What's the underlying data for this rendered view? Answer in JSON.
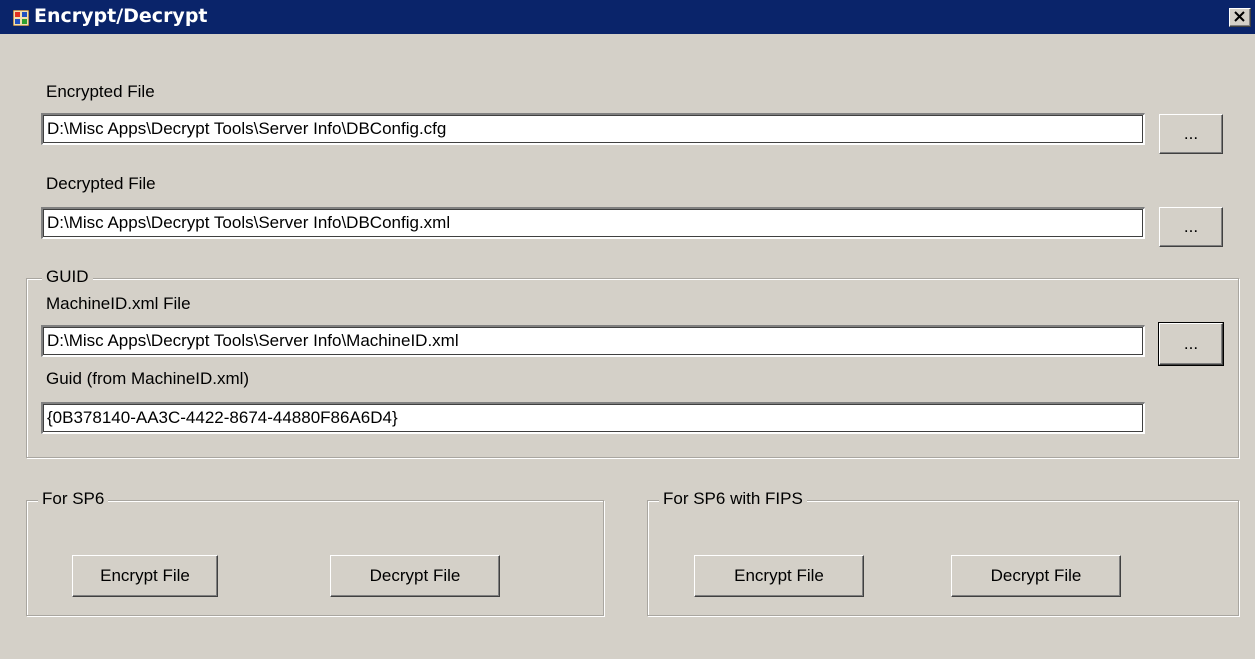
{
  "window": {
    "title": "Encrypt/Decrypt",
    "close_label": "✕"
  },
  "encrypted": {
    "label": "Encrypted File",
    "value": "D:\\Misc Apps\\Decrypt Tools\\Server Info\\DBConfig.cfg",
    "browse_label": "..."
  },
  "decrypted": {
    "label": "Decrypted File",
    "value": "D:\\Misc Apps\\Decrypt Tools\\Server Info\\DBConfig.xml",
    "browse_label": "..."
  },
  "guid_group": {
    "legend": "GUID",
    "machine_label": "MachineID.xml File",
    "machine_value": "D:\\Misc Apps\\Decrypt Tools\\Server Info\\MachineID.xml",
    "browse_label": "...",
    "guid_label": "Guid (from MachineID.xml)",
    "guid_value": "{0B378140-AA3C-4422-8674-44880F86A6D4}"
  },
  "sp6_group": {
    "legend": "For SP6",
    "encrypt_label": "Encrypt File",
    "decrypt_label": "Decrypt File"
  },
  "sp6_fips_group": {
    "legend": "For SP6 with FIPS",
    "encrypt_label": "Encrypt File",
    "decrypt_label": "Decrypt File"
  },
  "colors": {
    "titlebar": "#0a246a",
    "face": "#d4d0c8"
  }
}
